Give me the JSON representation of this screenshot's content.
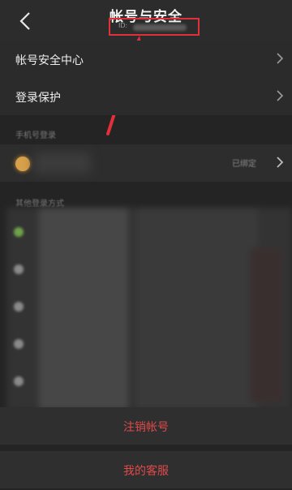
{
  "header": {
    "title": "帐号与安全",
    "id_label": "ID:"
  },
  "menu": [
    {
      "label": "帐号安全中心"
    },
    {
      "label": "登录保护"
    }
  ],
  "sections": {
    "phone_login": "手机号登录",
    "other_login": "其他登录方式"
  },
  "phone": {
    "status": "已绑定"
  },
  "buttons": {
    "deactivate": "注销帐号",
    "customer_service": "我的客服"
  },
  "colors": {
    "accent": "#e04a4a",
    "highlight_box": "#e0303a"
  }
}
